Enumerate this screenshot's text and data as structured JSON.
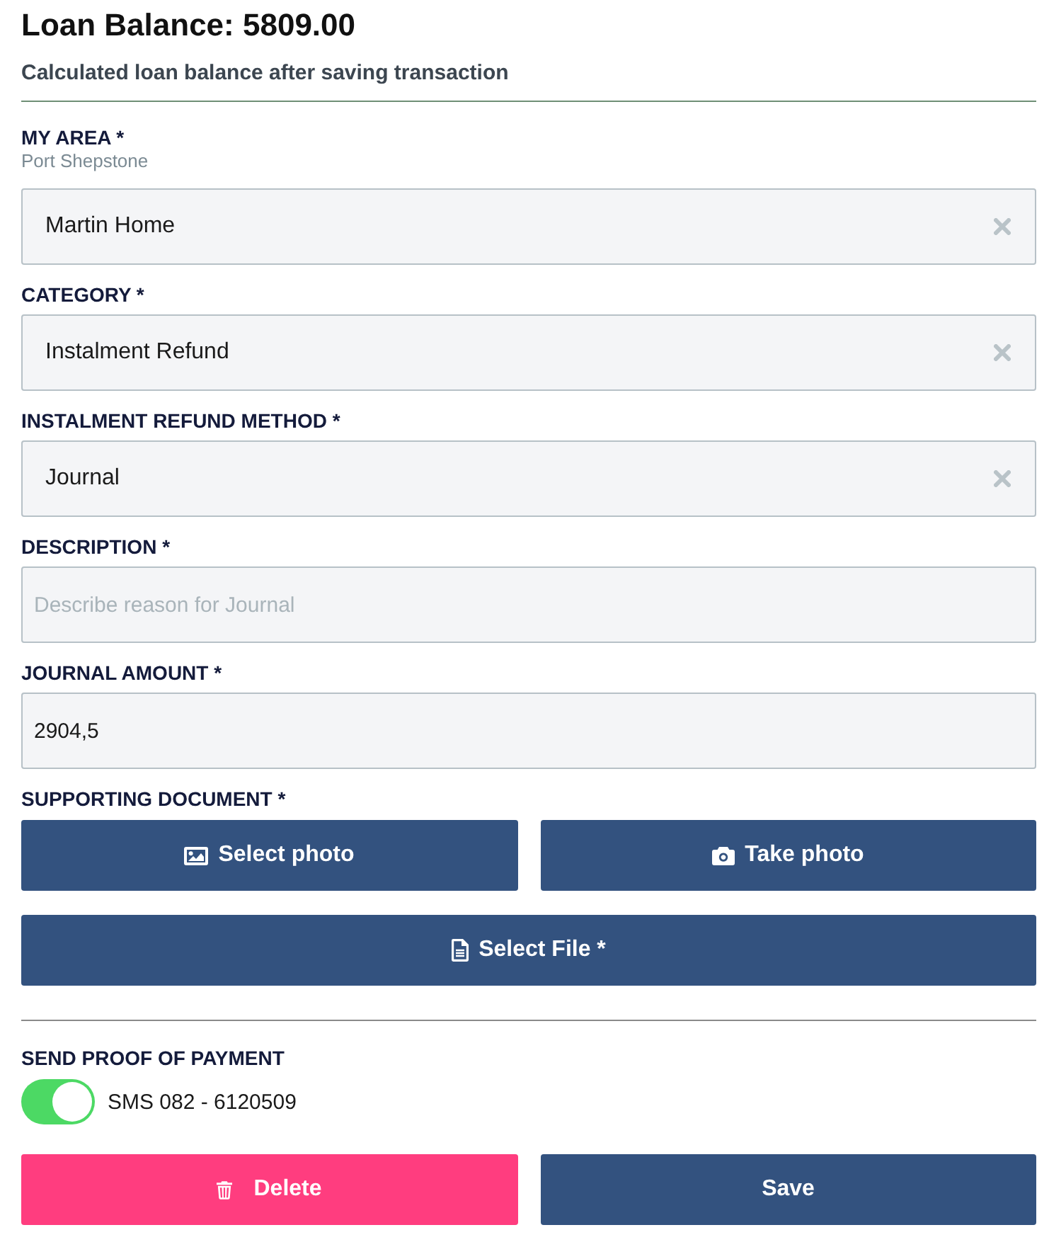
{
  "header": {
    "title": "Loan Balance: 5809.00",
    "subtitle": "Calculated loan balance after saving transaction"
  },
  "fields": [
    {
      "kind": "select",
      "label": "MY AREA *",
      "hint": "Port Shepstone",
      "value": "Martin Home"
    },
    {
      "kind": "select",
      "label": "CATEGORY *",
      "value": "Instalment Refund"
    },
    {
      "kind": "select",
      "label": "INSTALMENT REFUND METHOD *",
      "value": "Journal"
    },
    {
      "kind": "text",
      "label": "DESCRIPTION *",
      "placeholder": "Describe reason for Journal"
    },
    {
      "kind": "text",
      "label": "JOURNAL AMOUNT *",
      "value": "2904,5"
    }
  ],
  "supporting_document": {
    "label": "SUPPORTING DOCUMENT *",
    "buttons": [
      {
        "kind": "image",
        "label": "Select photo"
      },
      {
        "kind": "camera",
        "label": "Take photo"
      },
      {
        "kind": "file",
        "label": "Select File *"
      }
    ]
  },
  "proof_of_payment": {
    "label": "SEND PROOF OF PAYMENT",
    "toggle": {
      "on": true,
      "label": "SMS 082 - 6120509"
    }
  },
  "actions": [
    {
      "kind": "delete",
      "label": "Delete"
    },
    {
      "kind": "save",
      "label": "Save"
    }
  ]
}
